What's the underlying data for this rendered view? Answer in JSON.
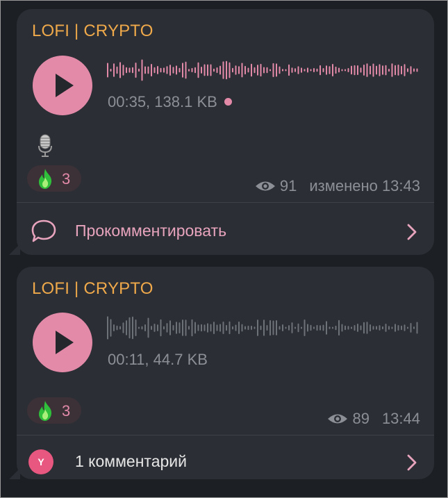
{
  "posts": [
    {
      "channel": "LOFI | CRYPTO",
      "audio": {
        "duration": "00:35",
        "size": "138.1 KB",
        "meta_text": "00:35, 138.1 KB",
        "unread": true,
        "played_fraction": 1.0
      },
      "caption_icon": "microphone-icon",
      "reaction": {
        "icon": "fire-icon",
        "count": "3"
      },
      "views": "91",
      "time_label": "изменено 13:43",
      "footer": {
        "icon": "comment-bubble-icon",
        "label": "Прокомментировать"
      }
    },
    {
      "channel": "LOFI | CRYPTO",
      "audio": {
        "duration": "00:11",
        "size": "44.7 KB",
        "meta_text": "00:11, 44.7 KB",
        "unread": false,
        "played_fraction": 0.0
      },
      "reaction": {
        "icon": "fire-icon",
        "count": "3"
      },
      "views": "89",
      "time_label": "13:44",
      "footer": {
        "avatar_letter": "Y",
        "label": "1 комментарий"
      }
    }
  ],
  "colors": {
    "accent_pink": "#e48aa9",
    "channel_orange": "#f0a94a",
    "bubble_bg": "#2b2f35",
    "muted_text": "#8c9096",
    "waveform_played": "#e48aa9",
    "waveform_unplayed": "#6d7278"
  }
}
